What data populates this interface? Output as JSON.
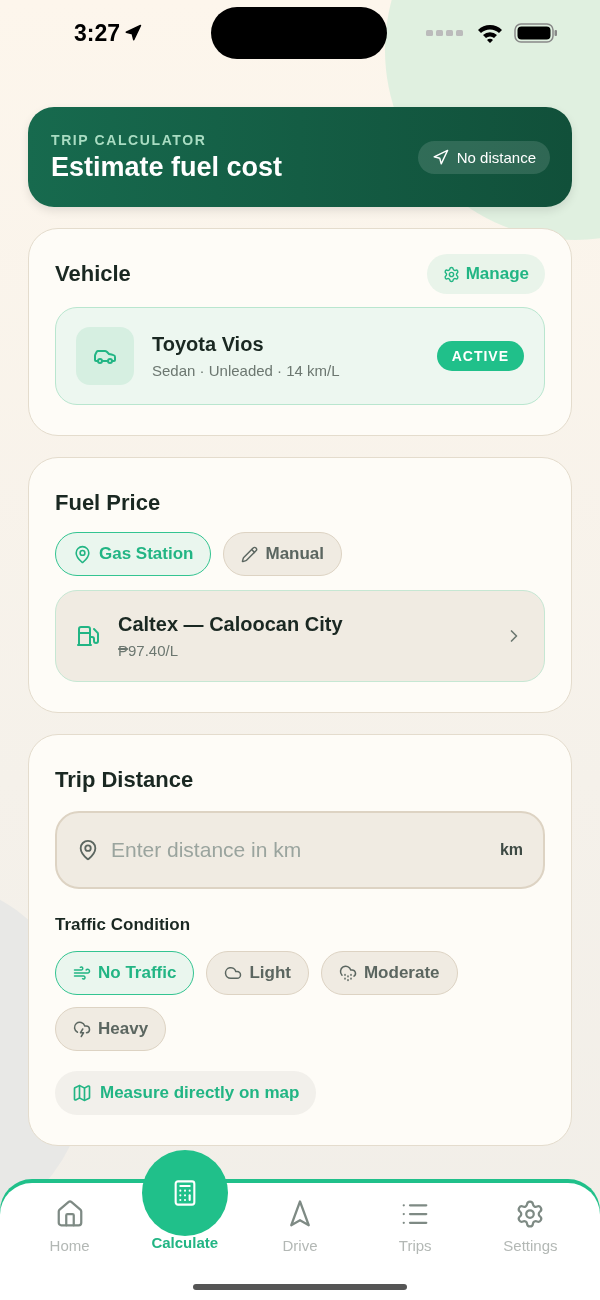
{
  "status_bar": {
    "time": "3:27"
  },
  "header": {
    "eyebrow": "TRIP CALCULATOR",
    "title": "Estimate fuel cost",
    "badge": "No distance"
  },
  "vehicle": {
    "title": "Vehicle",
    "manage_button": "Manage",
    "car": {
      "name": "Toyota Vios",
      "details": "Sedan · Unleaded · 14 km/L",
      "badge": "ACTIVE",
      "active": true
    }
  },
  "fuel_price": {
    "title": "Fuel Price",
    "sources": [
      {
        "label": "Gas Station",
        "kind": "pin",
        "selected": true
      },
      {
        "label": "Manual",
        "kind": "pencil",
        "selected": false
      }
    ],
    "station": {
      "name": "Caltex — Caloocan City",
      "price": "₱97.40/L"
    }
  },
  "trip_distance": {
    "title": "Trip Distance",
    "distance_field": {
      "placeholder": "Enter distance in km",
      "unit": "km"
    },
    "traffic_title": "Traffic Condition",
    "traffic_options": [
      {
        "label": "No Traffic",
        "kind": "wind",
        "selected": true
      },
      {
        "label": "Light",
        "kind": "cloud",
        "selected": false
      },
      {
        "label": "Moderate",
        "kind": "drizzle",
        "selected": false
      },
      {
        "label": "Heavy",
        "kind": "storm",
        "selected": false
      }
    ],
    "map_button": "Measure directly on map"
  },
  "tab_bar": [
    {
      "label": "Home",
      "kind": "home",
      "selected": false
    },
    {
      "label": "Calculate",
      "kind": "calculator",
      "selected": true
    },
    {
      "label": "Drive",
      "kind": "navigation",
      "selected": false
    },
    {
      "label": "Trips",
      "kind": "list",
      "selected": false
    },
    {
      "label": "Settings",
      "kind": "settings",
      "selected": false
    }
  ]
}
